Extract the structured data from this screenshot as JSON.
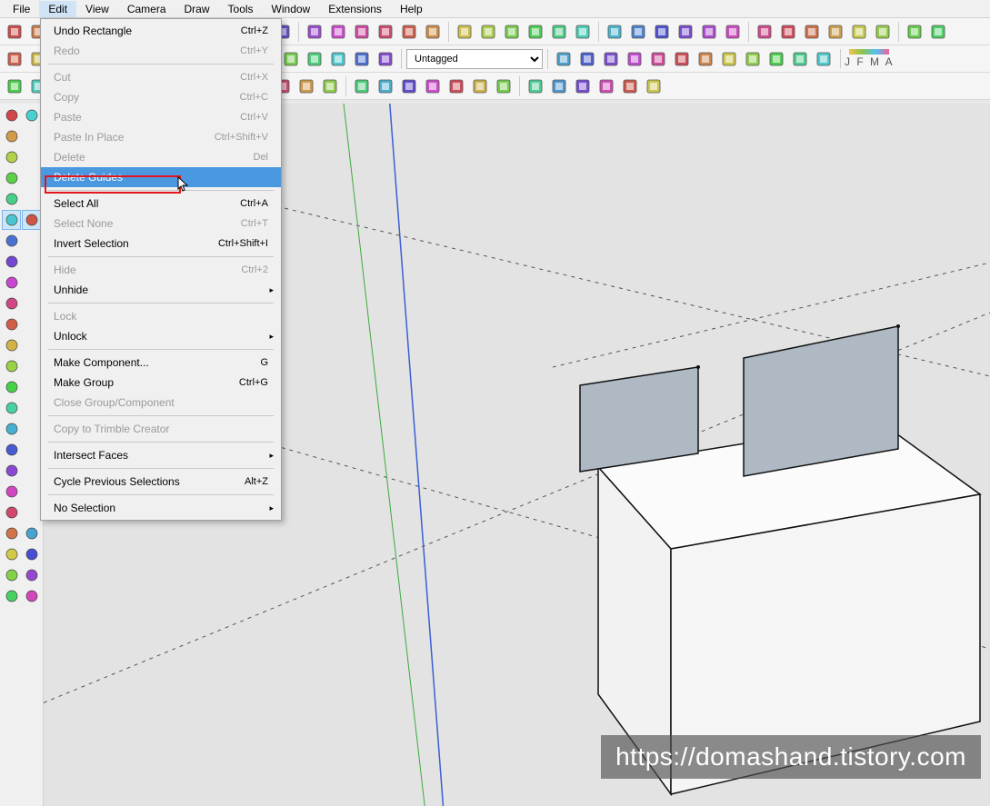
{
  "menu_bar": [
    "File",
    "Edit",
    "View",
    "Camera",
    "Draw",
    "Tools",
    "Window",
    "Extensions",
    "Help"
  ],
  "dropdown": {
    "groups": [
      [
        {
          "label": "Undo Rectangle",
          "shortcut": "Ctrl+Z",
          "enabled": true
        },
        {
          "label": "Redo",
          "shortcut": "Ctrl+Y",
          "enabled": false
        }
      ],
      [
        {
          "label": "Cut",
          "shortcut": "Ctrl+X",
          "enabled": false
        },
        {
          "label": "Copy",
          "shortcut": "Ctrl+C",
          "enabled": false
        },
        {
          "label": "Paste",
          "shortcut": "Ctrl+V",
          "enabled": false
        },
        {
          "label": "Paste In Place",
          "shortcut": "Ctrl+Shift+V",
          "enabled": false
        },
        {
          "label": "Delete",
          "shortcut": "Del",
          "enabled": false
        },
        {
          "label": "Delete Guides",
          "shortcut": "",
          "enabled": true,
          "highlighted": true
        }
      ],
      [
        {
          "label": "Select All",
          "shortcut": "Ctrl+A",
          "enabled": true
        },
        {
          "label": "Select None",
          "shortcut": "Ctrl+T",
          "enabled": false
        },
        {
          "label": "Invert Selection",
          "shortcut": "Ctrl+Shift+I",
          "enabled": true
        }
      ],
      [
        {
          "label": "Hide",
          "shortcut": "Ctrl+2",
          "enabled": false
        },
        {
          "label": "Unhide",
          "shortcut": "",
          "enabled": true,
          "submenu": true
        }
      ],
      [
        {
          "label": "Lock",
          "shortcut": "",
          "enabled": false
        },
        {
          "label": "Unlock",
          "shortcut": "",
          "enabled": true,
          "submenu": true
        }
      ],
      [
        {
          "label": "Make Component...",
          "shortcut": "G",
          "enabled": true
        },
        {
          "label": "Make Group",
          "shortcut": "Ctrl+G",
          "enabled": true
        },
        {
          "label": "Close Group/Component",
          "shortcut": "",
          "enabled": false
        }
      ],
      [
        {
          "label": "Copy to Trimble Creator",
          "shortcut": "",
          "enabled": false
        }
      ],
      [
        {
          "label": "Intersect Faces",
          "shortcut": "",
          "enabled": true,
          "submenu": true
        }
      ],
      [
        {
          "label": "Cycle Previous Selections",
          "shortcut": "Alt+Z",
          "enabled": true
        }
      ],
      [
        {
          "label": "No Selection",
          "shortcut": "",
          "enabled": true,
          "submenu": true
        }
      ]
    ]
  },
  "tag_dropdown": "Untagged",
  "jfma_label": "J  F  M  A",
  "watermark": "https://domashand.tistory.com",
  "toolbar_row1_icons": [
    "new",
    "open",
    "save",
    "cut",
    "copy",
    "paste",
    "undo",
    "redo",
    "print",
    "model-info",
    "box",
    "house",
    "dims",
    "cloud",
    "line",
    "arc",
    "freehand",
    "offset",
    "move",
    "rotate",
    "scale",
    "pushpull",
    "followme",
    "tape",
    "protractor",
    "text",
    "axis",
    "section",
    "walk",
    "lookaround",
    "zoom",
    "pan",
    "orbit",
    "iso",
    "zoom-extents",
    "prev-view",
    "next-view",
    "position-camera"
  ],
  "toolbar_row2_icons": [
    "select",
    "eraser",
    "line2",
    "rect",
    "circle",
    "poly",
    "home",
    "layers",
    "styles-a",
    "styles-b",
    "styles-c",
    "styles-d",
    "styles-e",
    "styles-f",
    "styles-g",
    "styles-h",
    "tag",
    "sandbox-a",
    "sandbox-b",
    "sandbox-c",
    "sandbox-d",
    "sandbox-e",
    "soften",
    "shadows",
    "fog",
    "edge",
    "profile",
    "info"
  ],
  "toolbar_row3_icons": [
    "pencil",
    "eraser2",
    "r1",
    "r2",
    "r3",
    "r4",
    "r5",
    "r6",
    "r7",
    "r8",
    "r9",
    "r10",
    "bulb",
    "paint",
    "push",
    "follow",
    "offset2",
    "sphere",
    "s-red",
    "s-green",
    "s-blue",
    "s-box",
    "s-ball",
    "s-cyl",
    "s-cone",
    "s-torus",
    "wire"
  ],
  "left_tools": [
    [
      "puzzle-red",
      "puzzle-blue"
    ],
    [
      "wrench",
      ""
    ],
    [
      "shape-red",
      ""
    ],
    [
      "shape-blue",
      ""
    ],
    [
      "box-blue",
      ""
    ],
    [
      "cursor",
      "selected"
    ],
    [
      "brush",
      ""
    ],
    [
      "brush2",
      ""
    ],
    [
      "pencil-red",
      ""
    ],
    [
      "red-circle",
      ""
    ],
    [
      "arc-red",
      ""
    ],
    [
      "move-red",
      ""
    ],
    [
      "cyan-box",
      ""
    ],
    [
      "rotate",
      ""
    ],
    [
      "scale",
      ""
    ],
    [
      "tape",
      ""
    ],
    [
      "paint-green",
      ""
    ],
    [
      "paint-green2",
      ""
    ],
    [
      "orbit",
      ""
    ],
    [
      "cursor-black",
      ""
    ],
    [
      "zoom",
      "footprints"
    ],
    [
      "eye",
      "cross"
    ],
    [
      "blue-a",
      "blue-b"
    ],
    [
      "blue-c",
      "blue-d"
    ]
  ],
  "colors": {
    "viewport_bg": "#e3e3e3",
    "highlight": "#4a98e0",
    "red_annotation": "#e0161c",
    "face_blue": "#aeb9c4",
    "face_white": "#f8f8f8",
    "axis_blue": "#3b5fd4",
    "axis_green": "#3da93d"
  }
}
